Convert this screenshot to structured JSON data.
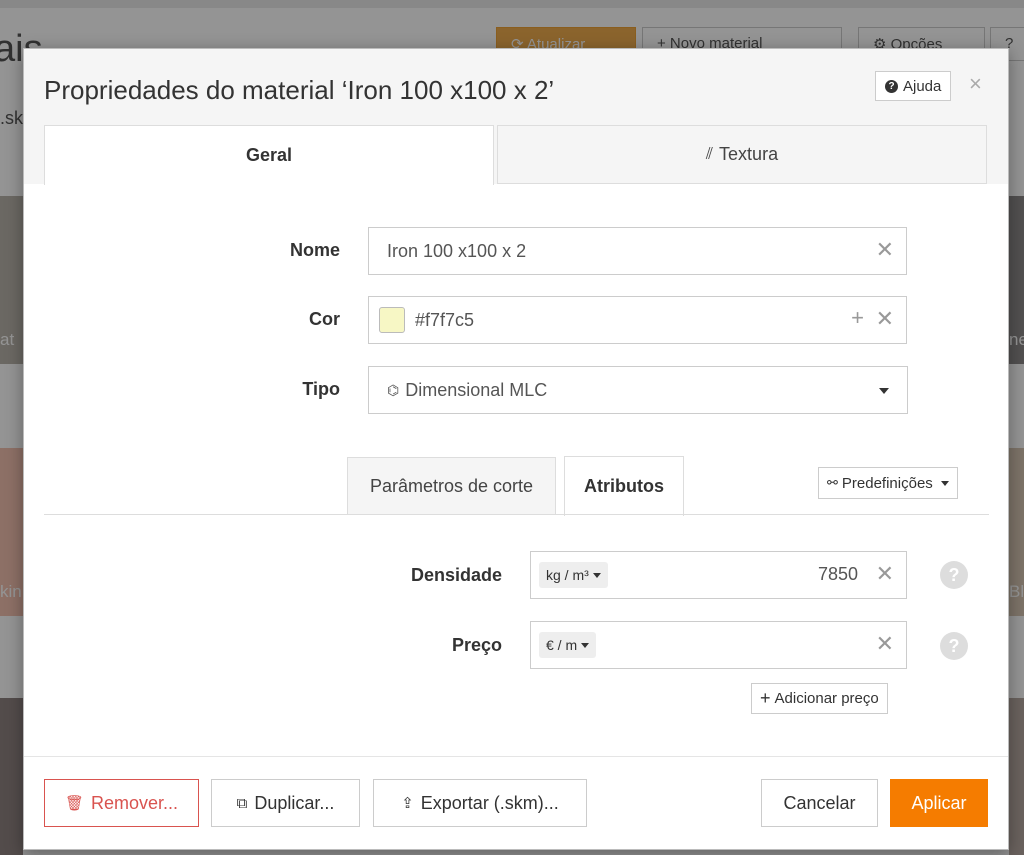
{
  "background": {
    "title_fragment": "ais",
    "update_button": "Atualizar",
    "new_material_button": "+ Novo material",
    "options_button": "Opções",
    "search_fragment": ".sk",
    "card_labels": [
      "at",
      "ne",
      "kin",
      "Bl"
    ]
  },
  "modal": {
    "title": "Propriedades do material ‘Iron 100 x100 x 2’",
    "help_label": "Ajuda",
    "close_symbol": "×",
    "tabs": [
      {
        "label": "Geral",
        "active": true
      },
      {
        "label": "Textura",
        "active": false
      }
    ],
    "form": {
      "name_label": "Nome",
      "name_value": "Iron 100 x100 x 2",
      "color_label": "Cor",
      "color_value": "#f7f7c5",
      "type_label": "Tipo",
      "type_value": "Dimensional MLC"
    },
    "inner_tabs": [
      {
        "label": "Parâmetros de corte",
        "active": false
      },
      {
        "label": "Atributos",
        "active": true
      }
    ],
    "presets_label": "Predefinições",
    "attributes": {
      "density_label": "Densidade",
      "density_unit": "kg / m³",
      "density_value": "7850",
      "price_label": "Preço",
      "price_unit": "€ / m",
      "price_value": "",
      "add_price_label": "Adicionar preço"
    },
    "footer": {
      "remove": "Remover...",
      "duplicate": "Duplicar...",
      "export": "Exportar (.skm)...",
      "cancel": "Cancelar",
      "apply": "Aplicar"
    }
  },
  "colors": {
    "accent": "#f57c00",
    "danger": "#d9534f",
    "swatch": "#f7f7c5",
    "update_button_bg": "#f0ad4e"
  }
}
